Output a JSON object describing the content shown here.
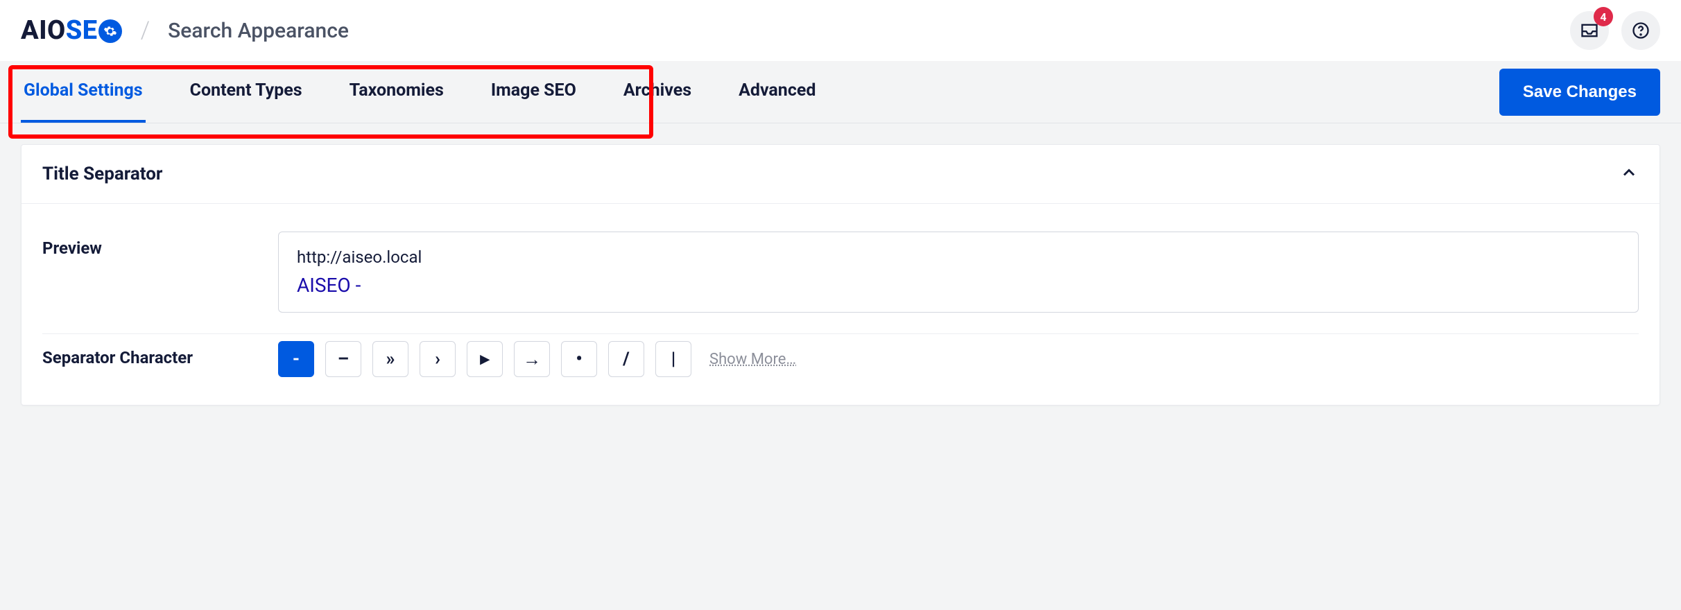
{
  "header": {
    "logo_aio": "AIO",
    "logo_se": "SE",
    "page_title": "Search Appearance",
    "notification_count": "4"
  },
  "tabs": {
    "items": [
      {
        "label": "Global Settings",
        "active": true
      },
      {
        "label": "Content Types",
        "active": false
      },
      {
        "label": "Taxonomies",
        "active": false
      },
      {
        "label": "Image SEO",
        "active": false
      },
      {
        "label": "Archives",
        "active": false
      },
      {
        "label": "Advanced",
        "active": false
      }
    ],
    "save_button": "Save Changes"
  },
  "card": {
    "title": "Title Separator",
    "preview_label": "Preview",
    "preview_url": "http://aiseo.local",
    "preview_title": "AISEO -",
    "separator_label": "Separator Character",
    "separators": [
      {
        "char": "-",
        "active": true
      },
      {
        "char": "–",
        "active": false
      },
      {
        "char": "»",
        "active": false
      },
      {
        "char": "›",
        "active": false
      },
      {
        "char": "▸",
        "active": false
      },
      {
        "char": "→",
        "active": false
      },
      {
        "char": "•",
        "active": false
      },
      {
        "char": "/",
        "active": false
      },
      {
        "char": "|",
        "active": false
      }
    ],
    "show_more": "Show More…"
  }
}
